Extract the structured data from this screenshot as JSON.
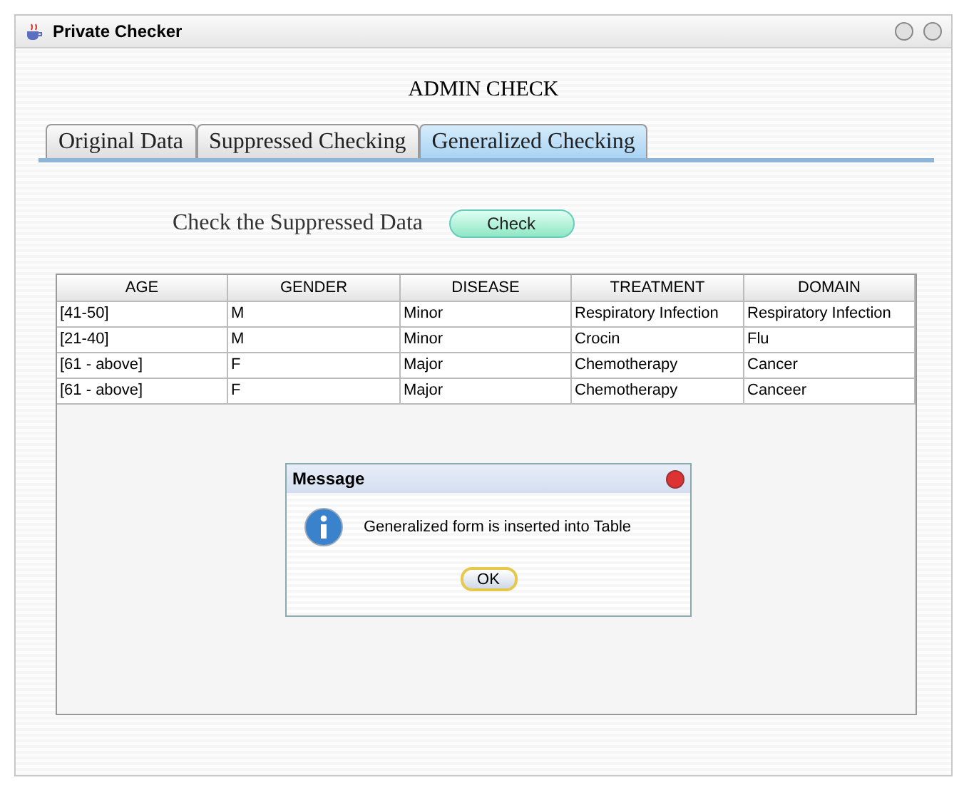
{
  "window": {
    "title": "Private Checker"
  },
  "heading": "ADMIN CHECK",
  "tabs": [
    {
      "label": "Original Data",
      "selected": false
    },
    {
      "label": "Suppressed Checking",
      "selected": false
    },
    {
      "label": "Generalized Checking",
      "selected": true
    }
  ],
  "check": {
    "label": "Check the Suppressed Data",
    "button": "Check"
  },
  "table": {
    "columns": [
      "AGE",
      "GENDER",
      "DISEASE",
      "TREATMENT",
      "DOMAIN"
    ],
    "rows": [
      [
        "[41-50]",
        "M",
        "Minor",
        "Respiratory Infection",
        "Respiratory Infection"
      ],
      [
        "[21-40]",
        "M",
        "Minor",
        "Crocin",
        "Flu"
      ],
      [
        "[61 - above]",
        "F",
        "Major",
        "Chemotherapy",
        "Cancer"
      ],
      [
        "[61 - above]",
        "F",
        "Major",
        "Chemotherapy",
        "Canceer"
      ]
    ]
  },
  "dialog": {
    "title": "Message",
    "message": "Generalized form is inserted into Table",
    "button": "OK"
  }
}
